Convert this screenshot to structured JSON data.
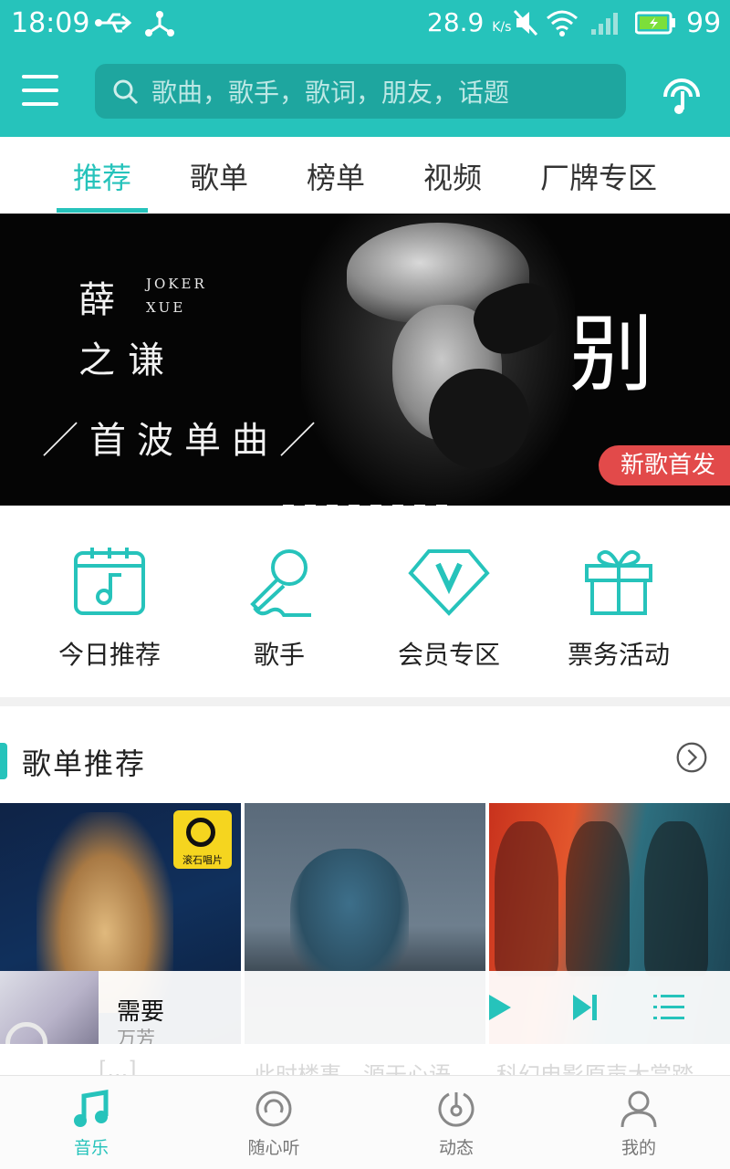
{
  "status_bar": {
    "time": "18:09",
    "speed_value": "28.9",
    "speed_unit": "K/s",
    "battery": "99"
  },
  "header": {
    "search_placeholder": "歌曲，歌手，歌词，朋友，话题"
  },
  "tabs": [
    {
      "label": "推荐",
      "active": true
    },
    {
      "label": "歌单",
      "active": false
    },
    {
      "label": "榜单",
      "active": false
    },
    {
      "label": "视频",
      "active": false
    },
    {
      "label": "厂牌专区",
      "active": false
    }
  ],
  "banner": {
    "artist_line1": "薛",
    "artist_line2": "之谦",
    "artist_en_line1": "JOKER",
    "artist_en_line2": "XUE",
    "subtitle": "／首波单曲／",
    "song_title": "别",
    "badge": "新歌首发",
    "slide_count": 8
  },
  "quick_links": [
    {
      "label": "今日推荐",
      "icon": "calendar-music-icon"
    },
    {
      "label": "歌手",
      "icon": "microphone-icon"
    },
    {
      "label": "会员专区",
      "icon": "vip-diamond-icon"
    },
    {
      "label": "票务活动",
      "icon": "gift-icon"
    }
  ],
  "section": {
    "title": "歌单推荐"
  },
  "playlist_cards": [
    {
      "label_logo": "滚石唱片"
    },
    {},
    {}
  ],
  "ghost_text": [
    "[...]",
    "此时楼事，源于心语",
    "科幻电影原声大赏踏"
  ],
  "mini_player": {
    "title": "需要",
    "artist": "万芳"
  },
  "bottom_nav": [
    {
      "label": "音乐",
      "icon": "music-note-icon",
      "active": true
    },
    {
      "label": "随心听",
      "icon": "radio-icon",
      "active": false
    },
    {
      "label": "动态",
      "icon": "feed-disc-icon",
      "active": false
    },
    {
      "label": "我的",
      "icon": "profile-icon",
      "active": false
    }
  ],
  "colors": {
    "accent": "#26c3bb",
    "badge_red": "#e24a4a"
  }
}
